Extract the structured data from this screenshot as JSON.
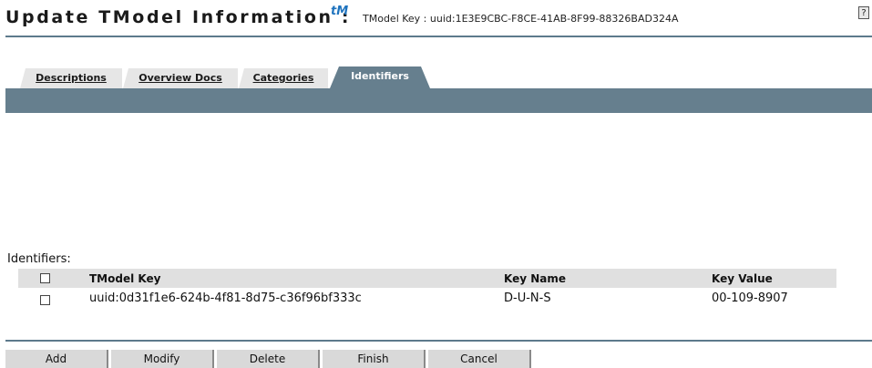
{
  "header": {
    "title": "Update TModel Information :",
    "tm_icon": "tM",
    "key_text": "TModel Key : uuid:1E3E9CBC-F8CE-41AB-8F99-88326BAD324A",
    "help_icon": "?"
  },
  "tabs": [
    {
      "label": "Descriptions",
      "active": false
    },
    {
      "label": "Overview Docs",
      "active": false
    },
    {
      "label": "Categories",
      "active": false
    },
    {
      "label": "Identifiers",
      "active": true
    }
  ],
  "identifiers": {
    "label": "Identifiers:",
    "columns": [
      "TModel Key",
      "Key Name",
      "Key Value"
    ],
    "rows": [
      {
        "tmodel_key": "uuid:0d31f1e6-624b-4f81-8d75-c36f96bf333c",
        "key_name": "D-U-N-S",
        "key_value": "00-109-8907",
        "checked": false
      }
    ]
  },
  "buttons": {
    "add": "Add",
    "modify": "Modify",
    "delete": "Delete",
    "finish": "Finish",
    "cancel": "Cancel"
  },
  "colors": {
    "tab_bar": "#667f8e",
    "rule": "#5d7a8c",
    "tm_icon": "#1e73be"
  }
}
